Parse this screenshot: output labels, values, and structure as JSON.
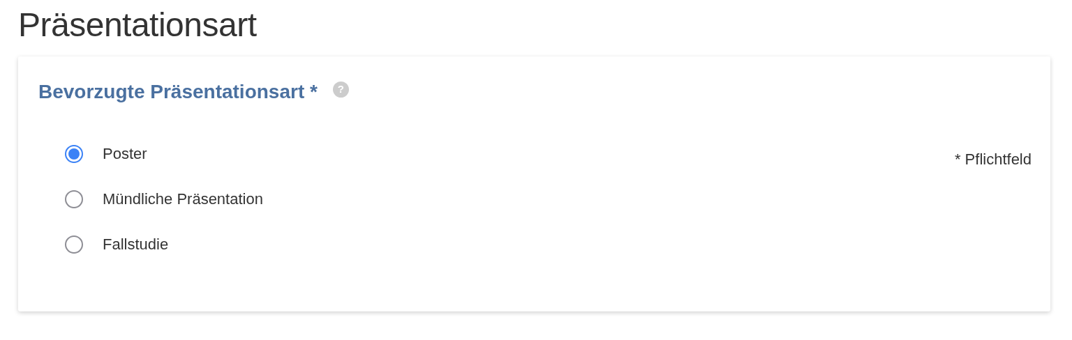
{
  "page_title": "Präsentationsart",
  "card": {
    "title": "Bevorzugte Präsentationsart *",
    "help_icon": "?",
    "required_note": "* Pflichtfeld",
    "options": [
      {
        "label": "Poster",
        "selected": true
      },
      {
        "label": "Mündliche Präsentation",
        "selected": false
      },
      {
        "label": "Fallstudie",
        "selected": false
      }
    ]
  }
}
